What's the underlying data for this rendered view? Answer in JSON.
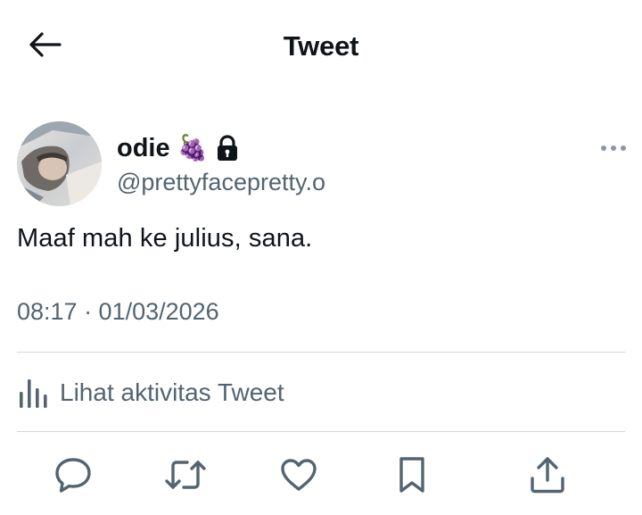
{
  "header": {
    "title": "Tweet",
    "back_icon": "arrow-left-icon"
  },
  "author": {
    "display_name": "odie",
    "emoji": "🍇",
    "protected_icon": "lock-icon",
    "handle": "@prettyfacepretty.o"
  },
  "tweet": {
    "text": "Maaf mah ke julius, sana.",
    "timestamp": "08:17 · 01/03/2026"
  },
  "activity": {
    "label": "Lihat aktivitas Tweet",
    "icon": "analytics-icon"
  },
  "actions": [
    {
      "icon": "reply-icon"
    },
    {
      "icon": "retweet-icon"
    },
    {
      "icon": "like-icon"
    },
    {
      "icon": "bookmark-icon"
    },
    {
      "icon": "share-icon"
    }
  ],
  "colors": {
    "text_primary": "#0f1419",
    "text_secondary": "#536471",
    "divider": "#cfd9de"
  }
}
